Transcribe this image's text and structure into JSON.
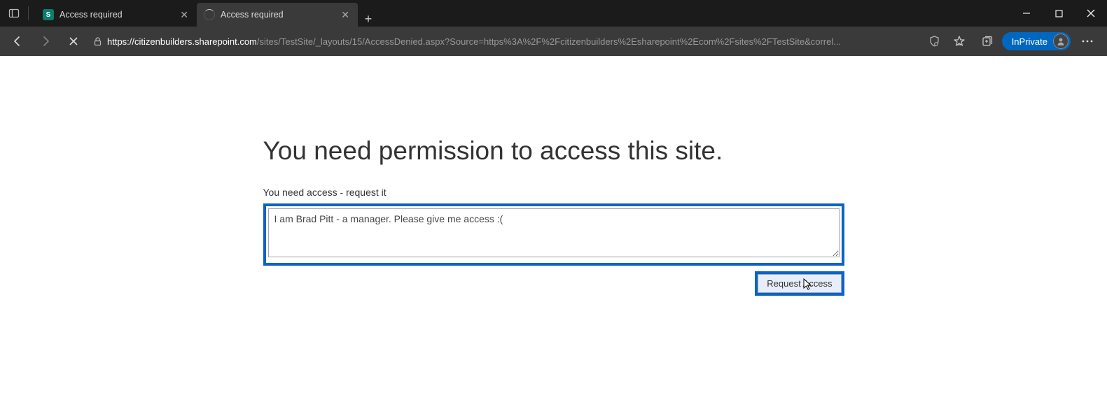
{
  "browser": {
    "tabs": [
      {
        "title": "Access required",
        "favicon": "sp",
        "active": false
      },
      {
        "title": "Access required",
        "favicon": "loading",
        "active": true
      }
    ],
    "url_host": "https://citizenbuilders.sharepoint.com",
    "url_path": "/sites/TestSite/_layouts/15/AccessDenied.aspx?Source=https%3A%2F%2Fcitizenbuilders%2Esharepoint%2Ecom%2Fsites%2FTestSite&correl...",
    "inprivate_label": "InPrivate"
  },
  "page": {
    "headline": "You need permission to access this site.",
    "subtext": "You need access - request it",
    "textarea_value": "I am Brad Pitt - a manager. Please give me access :(",
    "button_label": "Request Access"
  }
}
